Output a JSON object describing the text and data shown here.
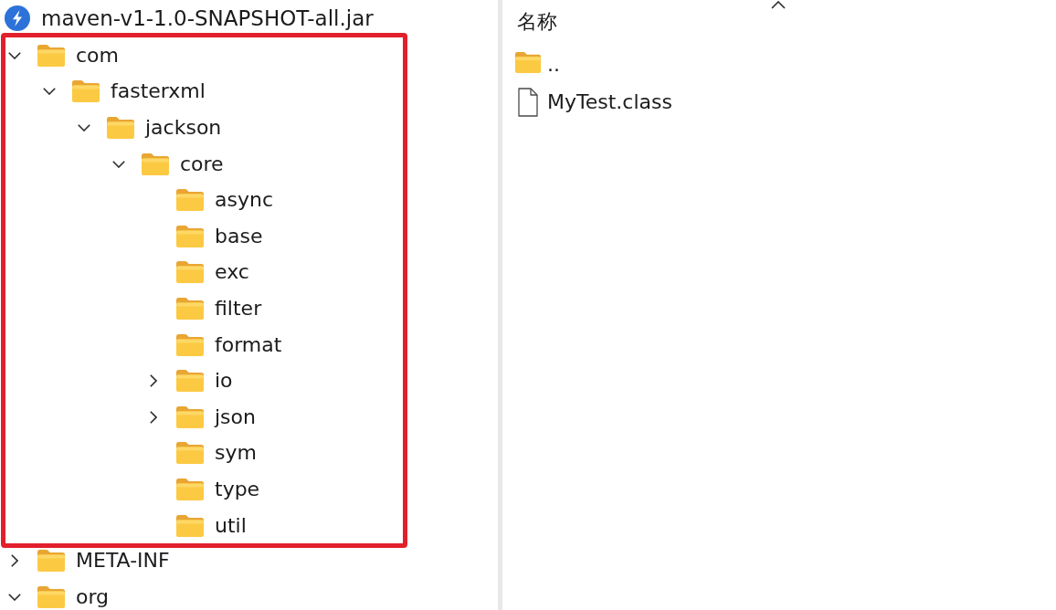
{
  "archive": {
    "name": "maven-v1-1.0-SNAPSHOT-all.jar"
  },
  "tree": [
    {
      "label": "com",
      "has_children": true,
      "expanded": true,
      "highlighted": true,
      "children": [
        {
          "label": "fasterxml",
          "has_children": true,
          "expanded": true,
          "children": [
            {
              "label": "jackson",
              "has_children": true,
              "expanded": true,
              "children": [
                {
                  "label": "core",
                  "has_children": true,
                  "expanded": true,
                  "children": [
                    {
                      "label": "async",
                      "has_children": false
                    },
                    {
                      "label": "base",
                      "has_children": false
                    },
                    {
                      "label": "exc",
                      "has_children": false
                    },
                    {
                      "label": "filter",
                      "has_children": false
                    },
                    {
                      "label": "format",
                      "has_children": false
                    },
                    {
                      "label": "io",
                      "has_children": true,
                      "expanded": false
                    },
                    {
                      "label": "json",
                      "has_children": true,
                      "expanded": false
                    },
                    {
                      "label": "sym",
                      "has_children": false
                    },
                    {
                      "label": "type",
                      "has_children": false
                    },
                    {
                      "label": "util",
                      "has_children": false
                    }
                  ]
                }
              ]
            }
          ]
        }
      ]
    },
    {
      "label": "META-INF",
      "has_children": true,
      "expanded": false,
      "highlighted": false
    },
    {
      "label": "org",
      "has_children": true,
      "expanded": true,
      "highlighted": false
    }
  ],
  "file_list": {
    "columns": [
      {
        "label": "名称",
        "sorted": true
      }
    ],
    "items": [
      {
        "kind": "folder",
        "name": ".."
      },
      {
        "kind": "file",
        "name": "MyTest.class"
      }
    ]
  }
}
